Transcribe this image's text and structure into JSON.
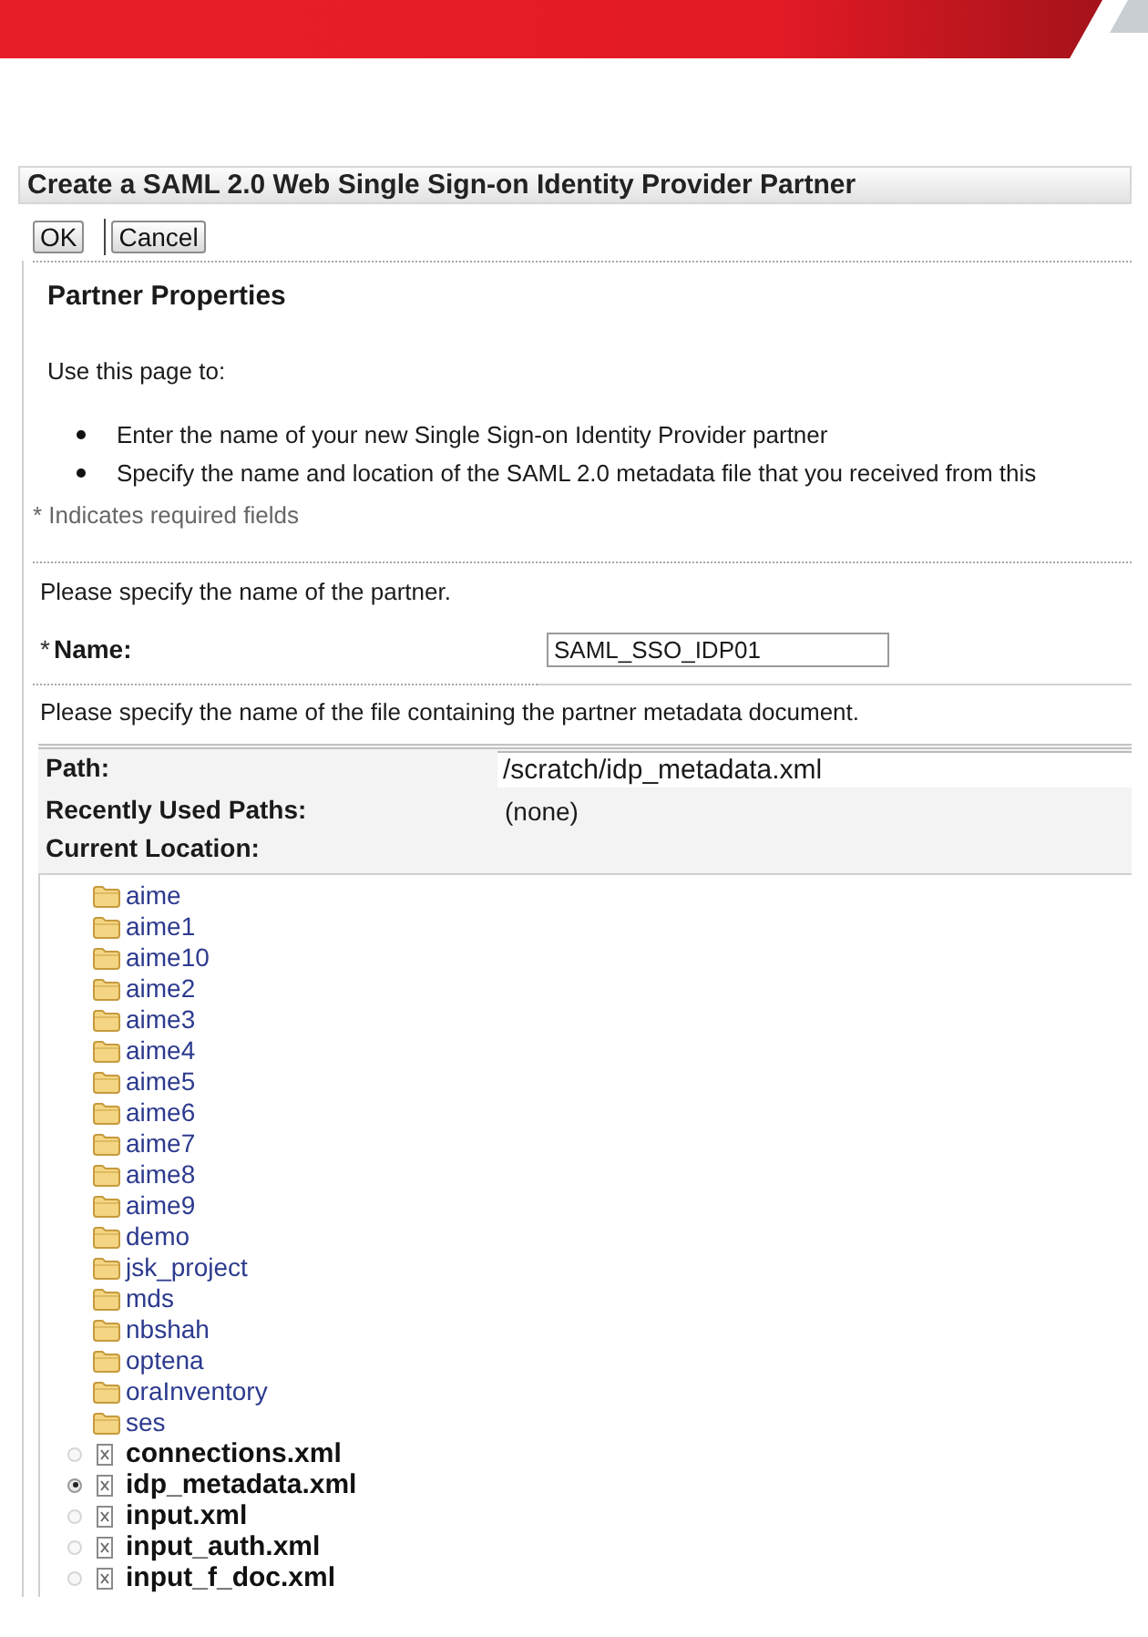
{
  "form": {
    "title": "Create a SAML 2.0 Web Single Sign-on Identity Provider Partner",
    "buttons": [
      "OK",
      "Cancel"
    ]
  },
  "partner_properties": {
    "heading": "Partner Properties",
    "intro": "Use this page to:",
    "bullets": [
      "Enter the name of your new Single Sign-on Identity Provider partner",
      "Specify the name and location of the SAML 2.0 metadata file that you received from this"
    ],
    "required_note": "* Indicates required fields"
  },
  "partner_name": {
    "prompt": "Please specify the name of the partner.",
    "required_mark": "*",
    "label": "Name:",
    "value": "SAML_SSO_IDP01"
  },
  "metadata_file": {
    "prompt": "Please specify the name of the file containing the partner metadata document.",
    "path_label": "Path:",
    "path_value": "/scratch/idp_metadata.xml",
    "recent_label": "Recently Used Paths:",
    "recent_value": "(none)",
    "location_label": "Current Location:",
    "entries": [
      {
        "kind": "folder",
        "name": "aime"
      },
      {
        "kind": "folder",
        "name": "aime1"
      },
      {
        "kind": "folder",
        "name": "aime10"
      },
      {
        "kind": "folder",
        "name": "aime2"
      },
      {
        "kind": "folder",
        "name": "aime3"
      },
      {
        "kind": "folder",
        "name": "aime4"
      },
      {
        "kind": "folder",
        "name": "aime5"
      },
      {
        "kind": "folder",
        "name": "aime6"
      },
      {
        "kind": "folder",
        "name": "aime7"
      },
      {
        "kind": "folder",
        "name": "aime8"
      },
      {
        "kind": "folder",
        "name": "aime9"
      },
      {
        "kind": "folder",
        "name": "demo"
      },
      {
        "kind": "folder",
        "name": "jsk_project"
      },
      {
        "kind": "folder",
        "name": "mds"
      },
      {
        "kind": "folder",
        "name": "nbshah"
      },
      {
        "kind": "folder",
        "name": "optena"
      },
      {
        "kind": "folder",
        "name": "oraInventory"
      },
      {
        "kind": "folder",
        "name": "ses"
      },
      {
        "kind": "file",
        "name": "connections.xml",
        "selected": false
      },
      {
        "kind": "file",
        "name": "idp_metadata.xml",
        "selected": true
      },
      {
        "kind": "file",
        "name": "input.xml",
        "selected": false
      },
      {
        "kind": "file",
        "name": "input_auth.xml",
        "selected": false
      },
      {
        "kind": "file",
        "name": "input_f_doc.xml",
        "selected": false
      }
    ]
  }
}
